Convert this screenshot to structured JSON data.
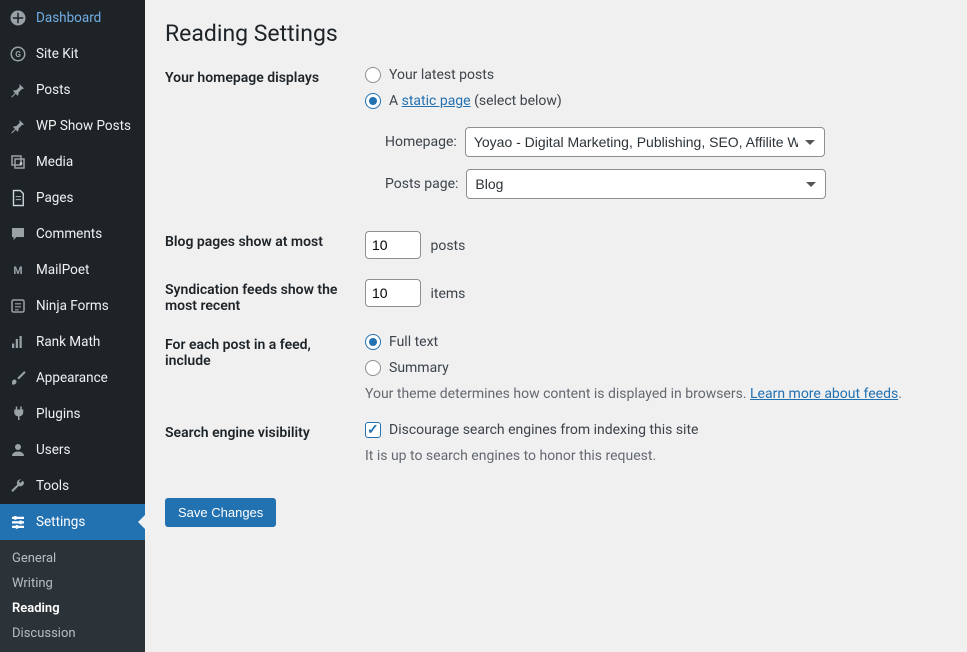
{
  "sidebar": {
    "items": [
      {
        "label": "Dashboard",
        "icon": "dashboard-icon"
      },
      {
        "label": "Site Kit",
        "icon": "sitekit-icon"
      },
      {
        "label": "Posts",
        "icon": "pin-icon"
      },
      {
        "label": "WP Show Posts",
        "icon": "pin-icon"
      },
      {
        "label": "Media",
        "icon": "media-icon"
      },
      {
        "label": "Pages",
        "icon": "pages-icon"
      },
      {
        "label": "Comments",
        "icon": "comments-icon"
      },
      {
        "label": "MailPoet",
        "icon": "mailpoet-icon"
      },
      {
        "label": "Ninja Forms",
        "icon": "forms-icon"
      },
      {
        "label": "Rank Math",
        "icon": "rankmath-icon"
      },
      {
        "label": "Appearance",
        "icon": "brush-icon"
      },
      {
        "label": "Plugins",
        "icon": "plugin-icon"
      },
      {
        "label": "Users",
        "icon": "users-icon"
      },
      {
        "label": "Tools",
        "icon": "tools-icon"
      },
      {
        "label": "Settings",
        "icon": "settings-icon",
        "active": true
      }
    ],
    "submenu": [
      {
        "label": "General"
      },
      {
        "label": "Writing"
      },
      {
        "label": "Reading",
        "current": true
      },
      {
        "label": "Discussion"
      }
    ]
  },
  "page": {
    "title": "Reading Settings",
    "save_label": "Save Changes"
  },
  "homepage_displays": {
    "label": "Your homepage displays",
    "opt_latest": "Your latest posts",
    "opt_static_prefix": "A",
    "opt_static_link": "static page",
    "opt_static_suffix": "(select below)",
    "homepage_label": "Homepage:",
    "homepage_value": "Yoyao - Digital Marketing, Publishing, SEO, Affilite Webs",
    "postspage_label": "Posts page:",
    "postspage_value": "Blog"
  },
  "blog_pages": {
    "label": "Blog pages show at most",
    "value": "10",
    "suffix": "posts"
  },
  "syndication": {
    "label": "Syndication feeds show the most recent",
    "value": "10",
    "suffix": "items"
  },
  "feed_include": {
    "label": "For each post in a feed, include",
    "opt_full": "Full text",
    "opt_summary": "Summary",
    "desc_prefix": "Your theme determines how content is displayed in browsers.",
    "desc_link": "Learn more about feeds",
    "desc_suffix": "."
  },
  "search_visibility": {
    "label": "Search engine visibility",
    "checkbox_label": "Discourage search engines from indexing this site",
    "description": "It is up to search engines to honor this request."
  }
}
